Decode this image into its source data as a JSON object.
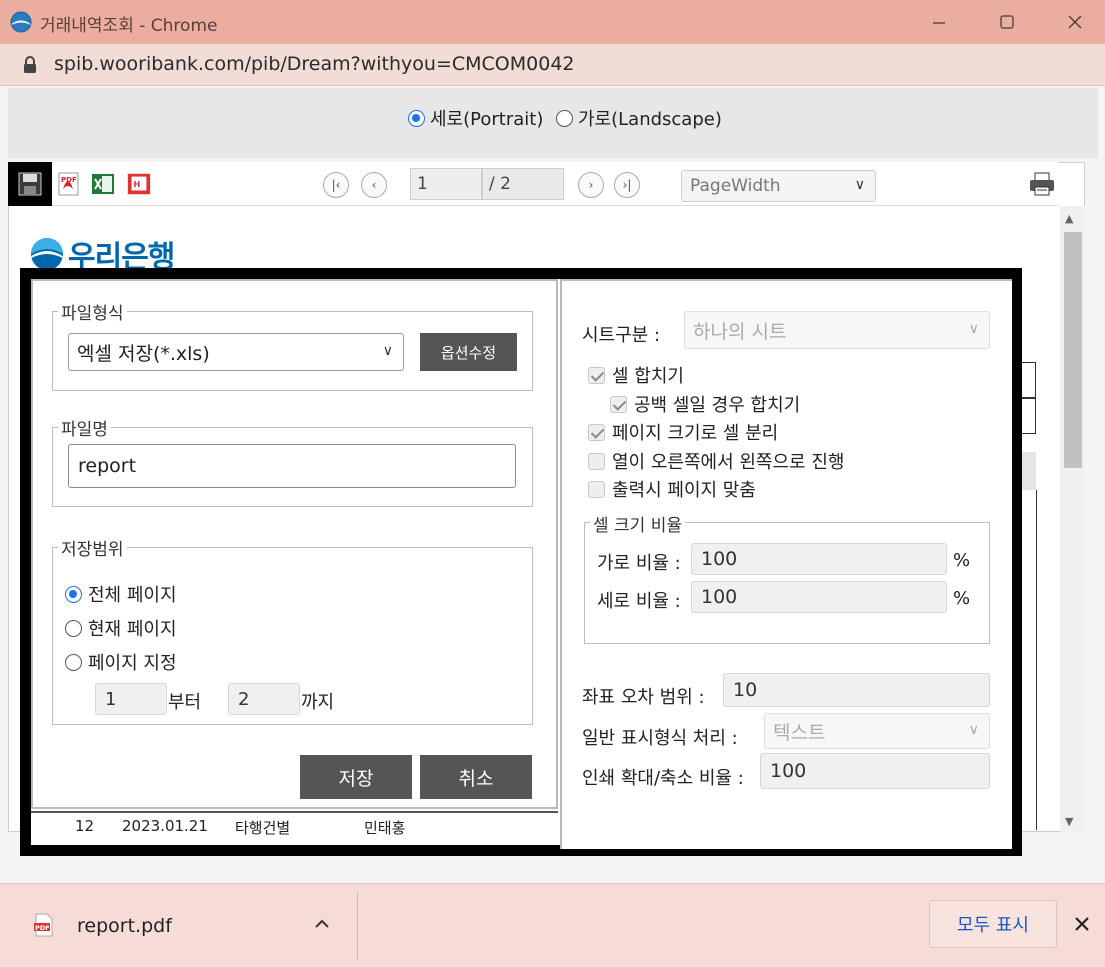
{
  "window": {
    "title": "거래내역조회 - Chrome",
    "url": "spib.wooribank.com/pib/Dream?withyou=CMCOM0042"
  },
  "orientation": {
    "portrait_label": "세로(Portrait)",
    "landscape_label": "가로(Landscape)",
    "selected": "portrait"
  },
  "viewer": {
    "page_current": "1",
    "page_total": "/ 2",
    "zoom_mode": "PageWidth",
    "bank_logo_text": "우리은행",
    "bg_row": {
      "no": "12",
      "date": "2023.01.21",
      "type": "타행건별",
      "name": "민태홍"
    }
  },
  "dialog": {
    "file_format": {
      "legend": "파일형식",
      "selected": "엑셀 저장(*.xls)",
      "option_button": "옵션수정"
    },
    "file_name": {
      "legend": "파일명",
      "value": "report"
    },
    "save_range": {
      "legend": "저장범위",
      "options": [
        "전체 페이지",
        "현재 페이지",
        "페이지 지정"
      ],
      "selected_index": 0,
      "from_value": "1",
      "from_label": "부터",
      "to_value": "2",
      "to_label": "까지"
    },
    "save_button": "저장",
    "cancel_button": "취소",
    "sheet": {
      "label": "시트구분 :",
      "selected": "하나의 시트"
    },
    "checkboxes": [
      {
        "label": "셀 합치기",
        "checked": true
      },
      {
        "label": "공백 셀일 경우 합치기",
        "checked": true
      },
      {
        "label": "페이지 크기로 셀 분리",
        "checked": true
      },
      {
        "label": "열이 오른쪽에서 왼쪽으로 진행",
        "checked": false
      },
      {
        "label": "출력시 페이지 맞춤",
        "checked": false
      }
    ],
    "cell_ratio": {
      "legend": "셀 크기 비율",
      "horizontal_label": "가로 비율 :",
      "horizontal_value": "100",
      "vertical_label": "세로 비율 :",
      "vertical_value": "100",
      "unit": "%"
    },
    "coord_error": {
      "label": "좌표 오차 범위 :",
      "value": "10"
    },
    "general_format": {
      "label": "일반 표시형식 처리 :",
      "selected": "텍스트"
    },
    "print_scale": {
      "label": "인쇄 확대/축소 비율 :",
      "value": "100"
    }
  },
  "downloads": {
    "file_name": "report.pdf",
    "show_all": "모두 표시"
  },
  "colors": {
    "titlebar": "#eaaea0",
    "accent_radio": "#1a73e8",
    "dark_button": "#555555",
    "bank_blue": "#0067ac"
  }
}
